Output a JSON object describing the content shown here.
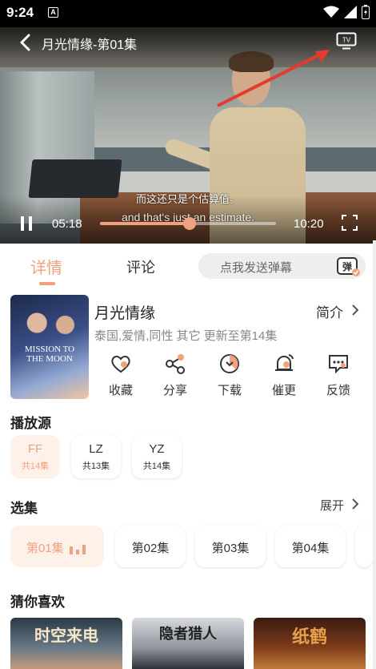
{
  "status_bar": {
    "time": "9:24",
    "notification_icon_label": "A"
  },
  "player": {
    "title": "月光情缘-第01集",
    "subtitle_cn": "而这还只是个估算值。",
    "subtitle_en": "and that's just an estimate.",
    "current_time": "05:18",
    "duration": "10:20",
    "progress": 0.51,
    "tv_label": "TV"
  },
  "tabs": {
    "detail": "详情",
    "comment": "评论"
  },
  "danmaku": {
    "placeholder": "点我发送弹幕",
    "icon_label": "弹"
  },
  "show": {
    "title": "月光情缘",
    "tags": "泰国,爱情,同性 其它 更新至第14集",
    "intro_label": "简介",
    "poster_text": "MISSION TO THE MOON"
  },
  "actions": [
    {
      "label": "收藏",
      "icon": "heart-icon"
    },
    {
      "label": "分享",
      "icon": "share-icon"
    },
    {
      "label": "下载",
      "icon": "download-icon"
    },
    {
      "label": "催更",
      "icon": "bell-icon"
    },
    {
      "label": "反馈",
      "icon": "feedback-icon"
    }
  ],
  "sources": {
    "title": "播放源",
    "items": [
      {
        "name": "FF",
        "count": "共14集",
        "active": true
      },
      {
        "name": "LZ",
        "count": "共13集",
        "active": false
      },
      {
        "name": "YZ",
        "count": "共14集",
        "active": false
      }
    ]
  },
  "episodes": {
    "title": "选集",
    "expand_label": "展开",
    "items": [
      {
        "label": "第01集",
        "active": true
      },
      {
        "label": "第02集",
        "active": false
      },
      {
        "label": "第03集",
        "active": false
      },
      {
        "label": "第04集",
        "active": false
      }
    ]
  },
  "recommend": {
    "title": "猜你喜欢",
    "items": [
      {
        "title": "时空来电"
      },
      {
        "title": "隐者猎人"
      },
      {
        "title": "纸鹤"
      }
    ]
  },
  "colors": {
    "accent": "#f0a27e",
    "accent_bg": "#fdf1ea",
    "arrow_red": "#e53a2f"
  }
}
